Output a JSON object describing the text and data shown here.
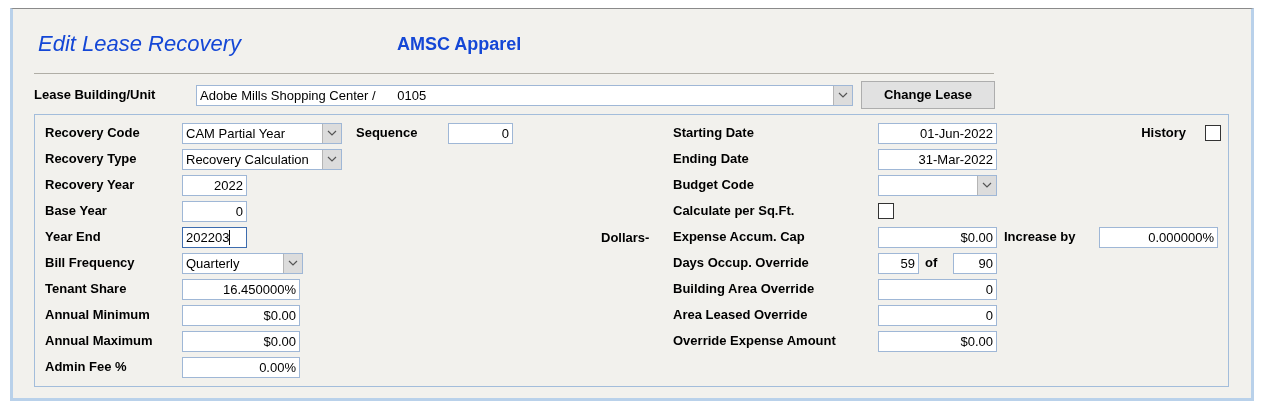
{
  "header": {
    "title": "Edit Lease Recovery",
    "company": "AMSC Apparel"
  },
  "lease": {
    "label": "Lease Building/Unit",
    "value": "Adobe Mills Shopping Center /      0105",
    "button": "Change Lease"
  },
  "left_fields": [
    {
      "label": "Recovery Code",
      "kind": "combo",
      "value": "CAM Partial Year",
      "focused": false
    },
    {
      "label": "Recovery Type",
      "kind": "combo",
      "value": "Recovery Calculation",
      "focused": false
    },
    {
      "label": "Recovery Year",
      "kind": "text",
      "value": "2022",
      "focused": false
    },
    {
      "label": "Base Year",
      "kind": "text",
      "value": "0",
      "focused": false
    },
    {
      "label": "Year End",
      "kind": "text",
      "value": "202203",
      "focused": true
    },
    {
      "label": "Bill Frequency",
      "kind": "combo",
      "value": "Quarterly",
      "focused": false
    },
    {
      "label": "Tenant Share",
      "kind": "text",
      "value": "16.450000%",
      "focused": false
    },
    {
      "label": "Annual Minimum",
      "kind": "text",
      "value": "$0.00",
      "focused": false
    },
    {
      "label": "Annual Maximum",
      "kind": "text",
      "value": "$0.00",
      "focused": false
    },
    {
      "label": "Admin Fee %",
      "kind": "text",
      "value": "0.00%",
      "focused": false
    }
  ],
  "sequence": {
    "label": "Sequence",
    "value": "0"
  },
  "history": {
    "label": "History",
    "checked": false
  },
  "right_fields": [
    {
      "label": "Starting Date",
      "kind": "text",
      "value": "01-Jun-2022"
    },
    {
      "label": "Ending Date",
      "kind": "text",
      "value": "31-Mar-2022"
    },
    {
      "label": "Budget Code",
      "kind": "combo"
    },
    {
      "label": "Calculate per Sq.Ft.",
      "kind": "checkbox",
      "checked": false
    },
    {
      "label": "Expense Accum. Cap",
      "kind": "text",
      "value": "$0.00",
      "prefix": "Dollars-",
      "extra": {
        "label": "Increase by",
        "value": "0.000000%"
      }
    },
    {
      "label": "Days Occup. Override",
      "kind": "pair",
      "value": "59",
      "joiner": "of",
      "total": "90"
    },
    {
      "label": "Building Area Override",
      "kind": "text",
      "value": "0"
    },
    {
      "label": "Area Leased Override",
      "kind": "text",
      "value": "0"
    },
    {
      "label": "Override Expense Amount",
      "kind": "text",
      "value": "$0.00"
    }
  ]
}
